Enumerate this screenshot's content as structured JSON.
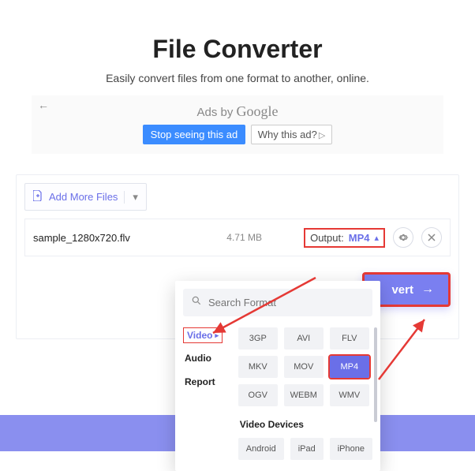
{
  "header": {
    "title": "File Converter",
    "subtitle": "Easily convert files from one format to another, online."
  },
  "ad": {
    "ads_by_prefix": "Ads by ",
    "ads_by_brand": "Google",
    "stop_label": "Stop seeing this ad",
    "why_label": "Why this ad?"
  },
  "toolbar": {
    "add_more_label": "Add More Files"
  },
  "file": {
    "name": "sample_1280x720.flv",
    "size": "4.71 MB"
  },
  "output": {
    "label": "Output:",
    "value": "MP4"
  },
  "actions": {
    "convert_label": "vert"
  },
  "dropdown": {
    "search_placeholder": "Search Format",
    "categories": {
      "video": "Video",
      "audio": "Audio",
      "report": "Report"
    },
    "formats": [
      "3GP",
      "AVI",
      "FLV",
      "MKV",
      "MOV",
      "MP4",
      "OGV",
      "WEBM",
      "WMV"
    ],
    "active_format": "MP4",
    "devices_label": "Video Devices",
    "devices": [
      "Android",
      "iPad",
      "iPhone"
    ]
  },
  "icons": {
    "file": "file-icon",
    "gear": "gear-icon",
    "close": "close-icon",
    "search": "search-icon",
    "chevron_down": "chevron-down-icon",
    "chevron_up": "chevron-up-icon",
    "arrow_right": "arrow-right-icon"
  },
  "colors": {
    "accent": "#6a6fe8",
    "highlight_border": "#e53935"
  }
}
